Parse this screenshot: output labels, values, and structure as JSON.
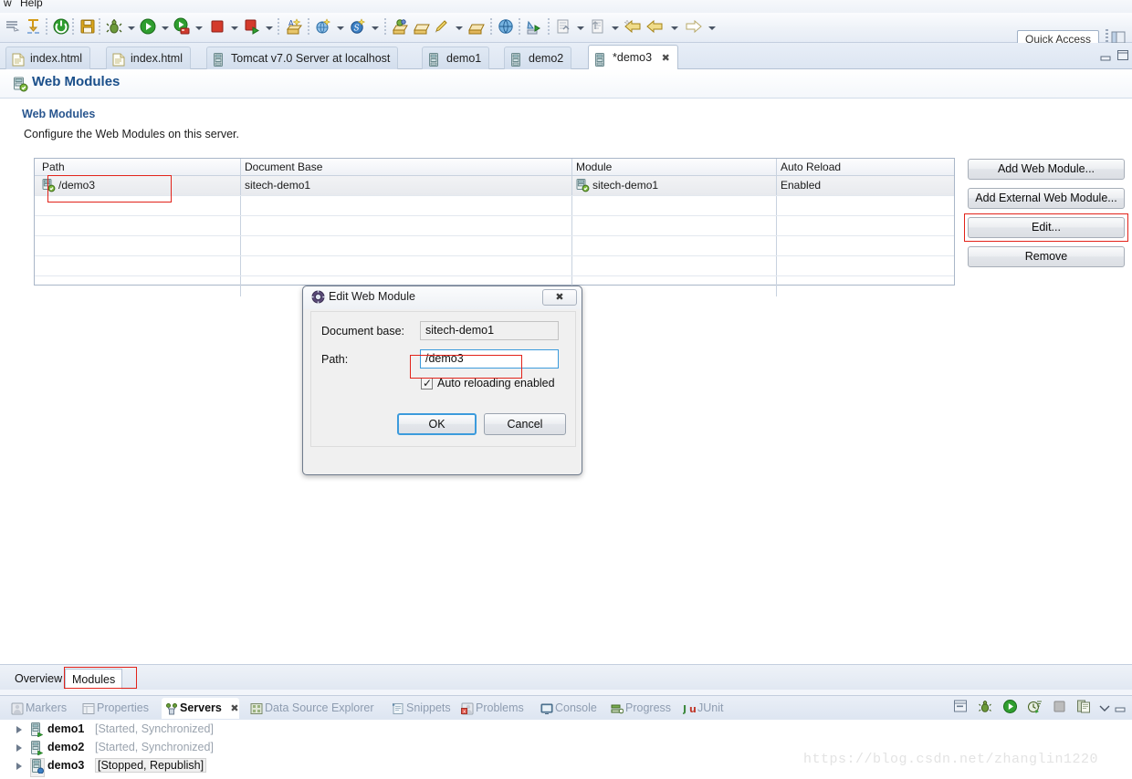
{
  "menubar": {
    "items": [
      "w",
      "Help"
    ]
  },
  "toolbar": {
    "quick_access": "Quick Access",
    "icons": [
      "new-wizard-icon",
      "new-java-package-icon",
      "power-toggle-icon",
      "save-icon",
      "debug-icon",
      "run-icon",
      "run-server-icon",
      "terminate-icon",
      "run-last-tool-icon",
      "new-java-project-icon",
      "new-web-project-icon",
      "new-spring-icon",
      "open-type-icon",
      "open-resource-icon",
      "edit-icon",
      "open-folder-icon",
      "open-browser-icon",
      "run-external-tool-icon",
      "next-annotation-icon",
      "previous-annotation-icon",
      "back-history-icon",
      "forward-history-icon"
    ]
  },
  "editor_tabs": [
    {
      "label": "index.html",
      "icon": "html-file-icon",
      "active": false,
      "dirty": false
    },
    {
      "label": "index.html",
      "icon": "html-file-icon",
      "active": false,
      "dirty": false
    },
    {
      "label": "Tomcat v7.0 Server at localhost",
      "icon": "server-icon",
      "active": false,
      "dirty": false
    },
    {
      "label": "demo1",
      "icon": "server-icon",
      "active": false,
      "dirty": false
    },
    {
      "label": "demo2",
      "icon": "server-icon",
      "active": false,
      "dirty": false
    },
    {
      "label": "*demo3",
      "icon": "server-icon",
      "active": true,
      "dirty": true,
      "close": "✖"
    }
  ],
  "form": {
    "header_title": "Web Modules",
    "header_icon": "web-module-icon",
    "section_title": "Web Modules",
    "section_desc": "Configure the Web Modules on this server."
  },
  "table": {
    "columns": [
      "Path",
      "Document Base",
      "Module",
      "Auto Reload"
    ],
    "rows": [
      {
        "path": "/demo3",
        "path_icon": "web-module-icon",
        "document_base": "sitech-demo1",
        "module": "sitech-demo1",
        "module_icon": "web-module-icon",
        "auto_reload": "Enabled",
        "selected": true
      }
    ],
    "empty_row_count": 5
  },
  "side_buttons": [
    {
      "label": "Add Web Module...",
      "highlighted": false
    },
    {
      "label": "Add External Web Module...",
      "highlighted": false
    },
    {
      "label": "Edit...",
      "highlighted": true
    },
    {
      "label": "Remove",
      "highlighted": false
    }
  ],
  "dialog": {
    "title": "Edit Web Module",
    "title_icon": "properties-gear-icon",
    "close_label": "✖",
    "document_base_label": "Document base:",
    "document_base_value": "sitech-demo1",
    "path_label": "Path:",
    "path_value": "/demo3",
    "checkbox_label": "Auto reloading enabled",
    "checkbox_checked": true,
    "checkbox_tick": "✓",
    "ok_label": "OK",
    "cancel_label": "Cancel"
  },
  "editor_bottom_tabs": [
    {
      "label": "Overview",
      "active": false
    },
    {
      "label": "Modules",
      "active": true
    }
  ],
  "view_tabs": [
    {
      "label": "Markers",
      "icon": "markers-icon",
      "active": false
    },
    {
      "label": "Properties",
      "icon": "properties-icon",
      "active": false
    },
    {
      "label": "Servers",
      "icon": "servers-icon",
      "active": true,
      "close": "✖"
    },
    {
      "label": "Data Source Explorer",
      "icon": "data-source-icon",
      "active": false
    },
    {
      "label": "Snippets",
      "icon": "snippets-icon",
      "active": false
    },
    {
      "label": "Problems",
      "icon": "problems-icon",
      "active": false
    },
    {
      "label": "Console",
      "icon": "console-icon",
      "active": false
    },
    {
      "label": "Progress",
      "icon": "progress-icon",
      "active": false
    },
    {
      "label": "JUnit",
      "icon": "junit-icon",
      "active": false
    }
  ],
  "view_toolbar_icons": [
    "new-server-icon",
    "debug-server-icon",
    "start-server-icon",
    "profile-server-icon",
    "stop-server-icon",
    "publish-icon",
    "view-menu-icon",
    "minimize-icon",
    "maximize-icon"
  ],
  "servers": [
    {
      "name": "demo1",
      "state": "[Started, Synchronized]",
      "icon": "server-started-icon",
      "selected": false
    },
    {
      "name": "demo2",
      "state": "[Started, Synchronized]",
      "icon": "server-started-icon",
      "selected": false
    },
    {
      "name": "demo3",
      "state": "[Stopped, Republish]",
      "icon": "server-stopped-icon",
      "selected": true
    }
  ],
  "watermark": "https://blog.csdn.net/zhanglin1220",
  "colors": {
    "accent_blue": "#1a4f8a",
    "annotation_red": "#e2231a",
    "focus_blue": "#3c9bdc",
    "muted_text": "#9aa3ae"
  }
}
